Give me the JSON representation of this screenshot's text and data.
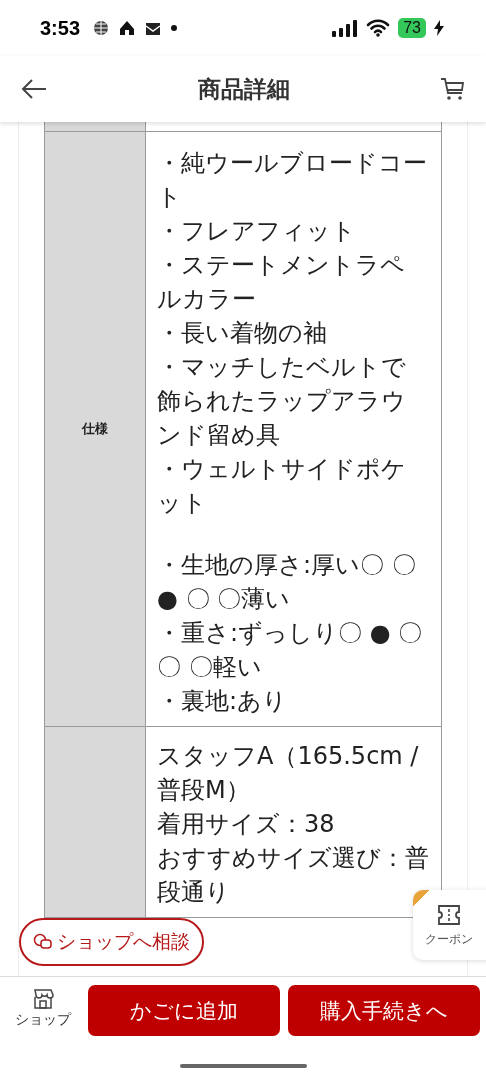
{
  "status_bar": {
    "time": "3:53",
    "battery": "73",
    "charging": true
  },
  "header": {
    "title": "商品詳細"
  },
  "table": {
    "rows": [
      {
        "label": "",
        "paragraphs": []
      },
      {
        "label": "仕様",
        "paragraphs": [
          [
            "・純ウールブロードコート",
            "・フレアフィット",
            "・ステートメントラペルカラー",
            "・長い着物の袖",
            "・マッチしたベルトで飾られたラップアラウンド留め具",
            "・ウェルトサイドポケット"
          ],
          [
            "・生地の厚さ:厚い〇 〇● 〇 〇薄い",
            "・重さ:ずっしり〇 ● 〇〇 〇軽い",
            "・裏地:あり"
          ]
        ]
      },
      {
        "label": "",
        "paragraphs": [
          [
            "スタッフA（165.5cm / 普段M）",
            "着用サイズ：38",
            "おすすめサイズ選び：普段通り"
          ]
        ]
      }
    ]
  },
  "consult_button": {
    "label": "ショップへ相談"
  },
  "coupon_tab": {
    "label": "クーポン"
  },
  "bottom_bar": {
    "shop_label": "ショップ",
    "buttons": [
      "かごに追加",
      "購入手続きへ"
    ]
  }
}
